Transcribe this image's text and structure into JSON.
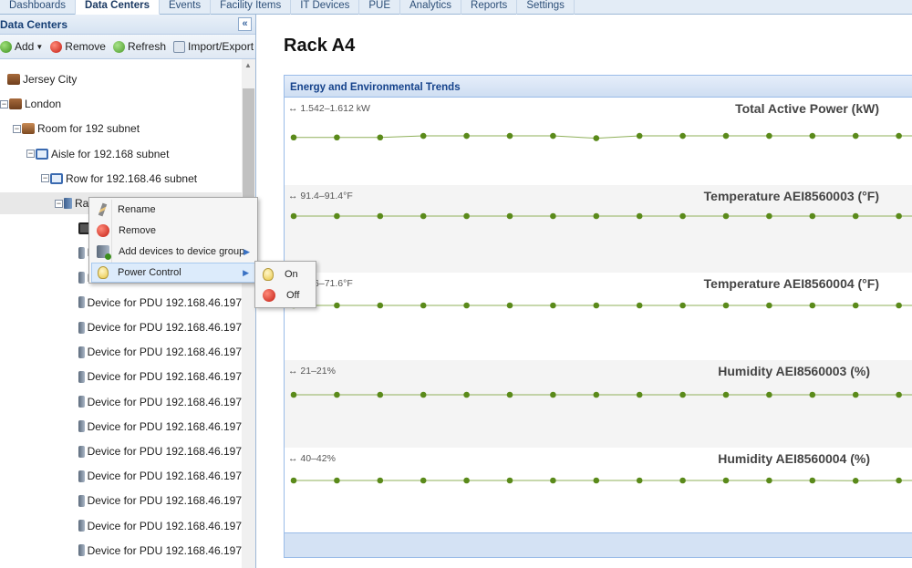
{
  "nav": {
    "tabs": [
      "Dashboards",
      "Data Centers",
      "Events",
      "Facility Items",
      "IT Devices",
      "PUE",
      "Analytics",
      "Reports",
      "Settings"
    ],
    "active_index": 1
  },
  "left_panel": {
    "title": "Data Centers",
    "collapse_glyph": "«",
    "toolbar": {
      "add": "Add",
      "remove": "Remove",
      "refresh": "Refresh",
      "import_export": "Import/Export"
    },
    "tree": [
      {
        "label": "Jersey City",
        "icon": "site-icon",
        "expander": ""
      },
      {
        "label": "London",
        "icon": "site-icon",
        "expander": "−"
      },
      {
        "label": "Room for 192 subnet",
        "icon": "room-icon",
        "expander": "−"
      },
      {
        "label": "Aisle for 192.168 subnet",
        "icon": "aisle-icon",
        "expander": "−"
      },
      {
        "label": "Row for 192.168.46 subnet",
        "icon": "aisle-icon",
        "expander": "−"
      },
      {
        "label": "Rack A4",
        "icon": "rack-icon",
        "expander": "−"
      },
      {
        "label": "",
        "icon": "device-group-icon",
        "expander": ""
      },
      {
        "label": "Device for PDU 192.168.46.197",
        "icon": "device-icon",
        "expander": ""
      },
      {
        "label": "Device for PDU 192.168.46.197",
        "icon": "device-icon",
        "expander": ""
      },
      {
        "label": "Device for PDU 192.168.46.197",
        "icon": "device-icon",
        "expander": ""
      },
      {
        "label": "Device for PDU 192.168.46.197",
        "icon": "device-icon",
        "expander": ""
      },
      {
        "label": "Device for PDU 192.168.46.197",
        "icon": "device-icon",
        "expander": ""
      },
      {
        "label": "Device for PDU 192.168.46.197",
        "icon": "device-icon",
        "expander": ""
      },
      {
        "label": "Device for PDU 192.168.46.197",
        "icon": "device-icon",
        "expander": ""
      },
      {
        "label": "Device for PDU 192.168.46.197",
        "icon": "device-icon",
        "expander": ""
      },
      {
        "label": "Device for PDU 192.168.46.197",
        "icon": "device-icon",
        "expander": ""
      },
      {
        "label": "Device for PDU 192.168.46.197",
        "icon": "device-icon",
        "expander": ""
      },
      {
        "label": "Device for PDU 192.168.46.197",
        "icon": "device-icon",
        "expander": ""
      },
      {
        "label": "Device for PDU 192.168.46.197",
        "icon": "device-icon",
        "expander": ""
      },
      {
        "label": "Device for PDU 192.168.46.197",
        "icon": "device-icon",
        "expander": ""
      },
      {
        "label": "Device for PDU 192.168.46.197",
        "icon": "device-icon",
        "expander": ""
      }
    ],
    "selected_index": 5
  },
  "context_menu": {
    "items": [
      {
        "label": "Rename",
        "icon": "pencil-icon",
        "has_submenu": false
      },
      {
        "label": "Remove",
        "icon": "remove-icon",
        "has_submenu": false
      },
      {
        "label": "Add devices to device group",
        "icon": "add-device-icon",
        "has_submenu": true
      },
      {
        "label": "Power Control",
        "icon": "lightbulb-icon",
        "has_submenu": true
      }
    ],
    "highlighted_index": 3,
    "submenu": [
      {
        "label": "On",
        "icon": "lightbulb-icon"
      },
      {
        "label": "Off",
        "icon": "remove-icon"
      }
    ]
  },
  "main": {
    "title": "Rack A4",
    "panel_title": "Energy and Environmental Trends"
  },
  "colors": {
    "accent": "#15428b",
    "series": "#5a8a1a",
    "series_line": "#8fb05a"
  },
  "chart_data": [
    {
      "type": "line",
      "title": "Total Active Power (kW)",
      "range_label": "↔ 1.542–1.612 kW",
      "values": [
        1.58,
        1.58,
        1.58,
        1.6,
        1.6,
        1.6,
        1.6,
        1.57,
        1.6,
        1.6,
        1.6,
        1.6,
        1.6,
        1.6,
        1.6
      ],
      "ylim": [
        1.542,
        1.612
      ]
    },
    {
      "type": "line",
      "title": "Temperature AEI8560003 (°F)",
      "range_label": "↔ 91.4–91.4°F",
      "values": [
        91.4,
        91.4,
        91.4,
        91.4,
        91.4,
        91.4,
        91.4,
        91.4,
        91.4,
        91.4,
        91.4,
        91.4,
        91.4,
        91.4,
        91.4
      ],
      "ylim": [
        91.4,
        91.4
      ]
    },
    {
      "type": "line",
      "title": "Temperature AEI8560004 (°F)",
      "range_label": "↔ 71.6–71.6°F",
      "values": [
        71.6,
        71.6,
        71.6,
        71.6,
        71.6,
        71.6,
        71.6,
        71.6,
        71.6,
        71.6,
        71.6,
        71.6,
        71.6,
        71.6,
        71.6
      ],
      "ylim": [
        71.6,
        71.6
      ]
    },
    {
      "type": "line",
      "title": "Humidity AEI8560003 (%)",
      "range_label": "↔ 21–21%",
      "values": [
        21,
        21,
        21,
        21,
        21,
        21,
        21,
        21,
        21,
        21,
        21,
        21,
        21,
        20.9,
        20.9
      ],
      "ylim": [
        21,
        21
      ]
    },
    {
      "type": "line",
      "title": "Humidity AEI8560004 (%)",
      "range_label": "↔ 40–42%",
      "values": [
        41,
        41,
        41,
        41,
        41,
        41,
        41,
        41,
        41,
        41,
        41,
        41,
        41,
        40.9,
        41
      ],
      "ylim": [
        40,
        42
      ]
    }
  ]
}
